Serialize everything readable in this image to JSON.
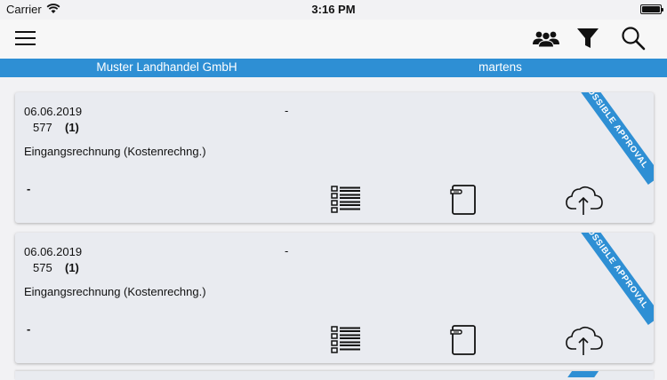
{
  "status_bar": {
    "carrier": "Carrier",
    "time": "3:16 PM"
  },
  "nav_icons": [
    "menu-icon",
    "group-icon",
    "filter-icon",
    "search-icon"
  ],
  "info_bar": {
    "company": "Muster Landhandel GmbH",
    "user": "martens"
  },
  "colors": {
    "accent": "#2e8fd4",
    "card_bg": "#e9ebf0",
    "page_bg": "#f2f2f4"
  },
  "cards": [
    {
      "date": "06.06.2019",
      "dash": "-",
      "number": "577",
      "count": "(1)",
      "doc_type": "Eingangsrechnung (Kostenrechng.)",
      "note": "-",
      "ribbon": "POSSIBLE APPROVAL",
      "actions": [
        "list-icon",
        "note-icon",
        "cloud-upload-icon"
      ]
    },
    {
      "date": "06.06.2019",
      "dash": "-",
      "number": "575",
      "count": "(1)",
      "doc_type": "Eingangsrechnung (Kostenrechng.)",
      "note": "-",
      "ribbon": "POSSIBLE APPROVAL",
      "actions": [
        "list-icon",
        "note-icon",
        "cloud-upload-icon"
      ]
    }
  ]
}
